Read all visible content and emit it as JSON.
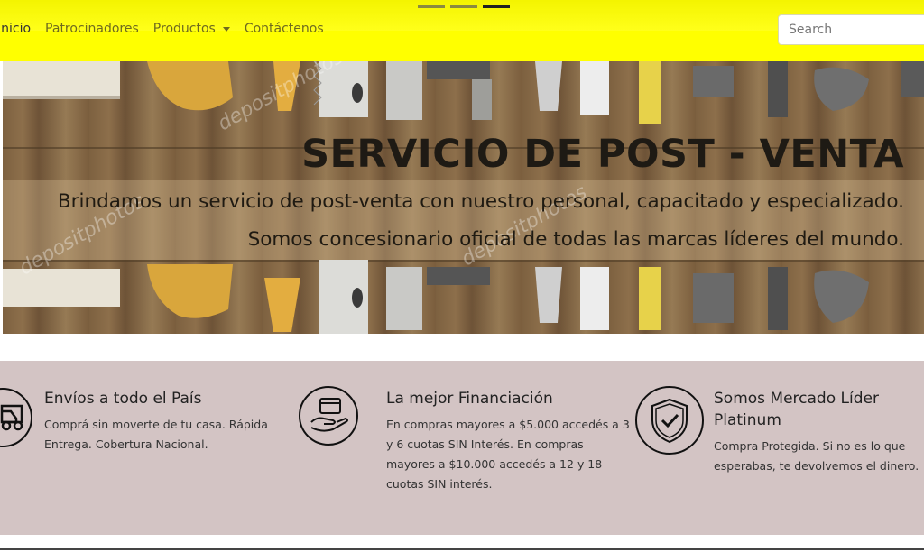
{
  "nav": {
    "links": [
      "Inicio",
      "Patrocinadores",
      "Productos",
      "Contáctenos"
    ],
    "search_placeholder": "Search",
    "bg_color": "#ffff00"
  },
  "banner": {
    "title": "SERVICIO DE POST - VENTA",
    "line1": "Brindamos un servicio de post-venta con nuestro personal, capacitado y especializado.",
    "line2": "Somos concesionario oficial de todas las marcas líderes del mundo.",
    "watermark": "depositphotos"
  },
  "features": {
    "bg_color": "#d3c4c4",
    "items": [
      {
        "title": "Envíos a todo el País",
        "text": "Comprá sin moverte de tu casa. Rápida Entrega. Cobertura Nacional.",
        "icon": "truck-icon"
      },
      {
        "title": "La mejor Financiación",
        "text": "En compras mayores a $5.000 accedés a 3 y 6 cuotas SIN Interés. En compras mayores a $10.000 accedés a 12 y 18 cuotas SIN interés.",
        "icon": "card-hand-icon"
      },
      {
        "title": "Somos Mercado Líder Platinum",
        "text": "Compra Protegida. Si no es lo que esperabas, te devolvemos el dinero.",
        "icon": "shield-check-icon"
      }
    ]
  }
}
